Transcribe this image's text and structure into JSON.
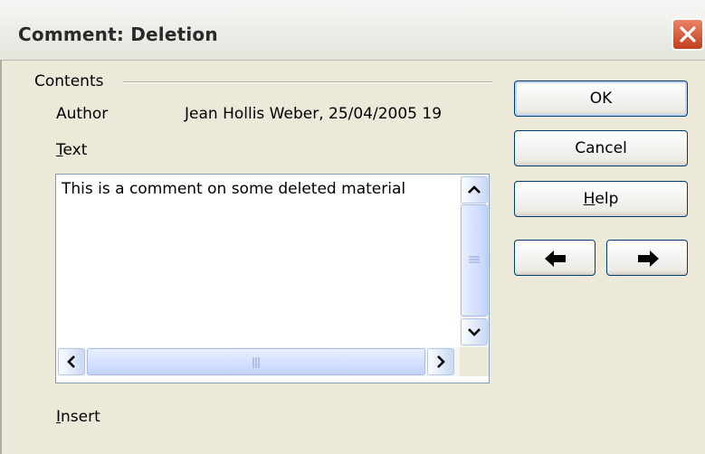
{
  "window": {
    "title": "Comment: Deletion"
  },
  "contents": {
    "group_label": "Contents",
    "author_label": "Author",
    "author_value": "Jean Hollis Weber, 25/04/2005 19",
    "text_label_mnemonic": "T",
    "text_label_rest": "ext",
    "text_value": "This is a comment on some deleted material",
    "insert_label_mnemonic": "I",
    "insert_label_rest": "nsert"
  },
  "buttons": {
    "ok": "OK",
    "cancel": "Cancel",
    "help_mnemonic": "H",
    "help_rest": "elp"
  },
  "icons": {
    "close": "close-icon",
    "prev": "arrow-left-icon",
    "next": "arrow-right-icon"
  },
  "colors": {
    "dialog_bg": "#ece9d8",
    "close_button": "#c2401d",
    "button_border": "#003c74"
  }
}
